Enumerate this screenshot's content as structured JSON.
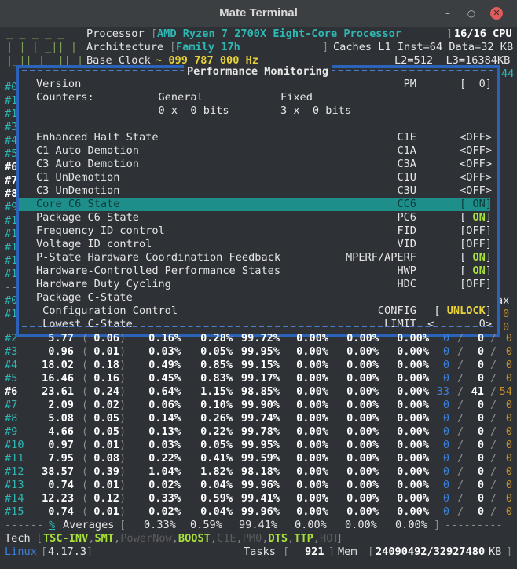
{
  "window": {
    "title": "Mate Terminal"
  },
  "header": {
    "processor_label": "Processor",
    "processor_value": "AMD Ryzen 7 2700X Eight-Core Processor",
    "cpu_count": "16/16 CPU",
    "arch_label": "Architecture",
    "arch_value": "Family 17h",
    "caches": "Caches L1 Inst=64 Data=32 KB",
    "clock_label": "Base Clock",
    "clock_value": "~ 099 787 000 Hz",
    "l2l3": "L2=512  L3=16384KB"
  },
  "modal": {
    "title": "Performance Monitoring",
    "rows": [
      {
        "label": "Version",
        "code": "PM",
        "value": "[  0]"
      },
      {
        "label": "Counters:          General            Fixed",
        "code": "",
        "value": ""
      },
      {
        "label": "                   0 x  0 bits        3 x  0 bits",
        "code": "",
        "value": ""
      },
      {
        "label": "",
        "code": "",
        "value": ""
      },
      {
        "label": "Enhanced Halt State",
        "code": "C1E",
        "value": "<OFF>"
      },
      {
        "label": "C1 Auto Demotion",
        "code": "C1A",
        "value": "<OFF>"
      },
      {
        "label": "C3 Auto Demotion",
        "code": "C3A",
        "value": "<OFF>"
      },
      {
        "label": "C1 UnDemotion",
        "code": "C1U",
        "value": "<OFF>"
      },
      {
        "label": "C3 UnDemotion",
        "code": "C3U",
        "value": "<OFF>"
      },
      {
        "label": "Core C6 State",
        "code": "CC6",
        "value": "[ ON]"
      },
      {
        "label": "Package C6 State",
        "code": "PC6",
        "value": "[ ON]"
      },
      {
        "label": "Frequency ID control",
        "code": "FID",
        "value": "[OFF]"
      },
      {
        "label": "Voltage ID control",
        "code": "VID",
        "value": "[OFF]"
      },
      {
        "label": "P-State Hardware Coordination Feedback",
        "code": "MPERF/APERF",
        "value": "[ ON]"
      },
      {
        "label": "Hardware-Controlled Performance States",
        "code": "HWP",
        "value": "[ ON]"
      },
      {
        "label": "Hardware Duty Cycling",
        "code": "HDC",
        "value": "[OFF]"
      },
      {
        "label": "Package C-State",
        "code": "",
        "value": ""
      },
      {
        "label": " Configuration Control",
        "code": "CONFIG",
        "value": "[ UNLOCK]"
      },
      {
        "label": " Lowest C-State",
        "code": "LIMIT",
        "value": "<       0>"
      }
    ],
    "highlight_index": 9
  },
  "left_margin": [
    "#0",
    "#1",
    "#1",
    "#3",
    "#4",
    "#5",
    "#6",
    "#7",
    "#8",
    "#9",
    "#1",
    "#1",
    "#1",
    "#1",
    "#1",
    "--",
    "#0",
    "#1"
  ],
  "right_margin": {
    "top": "44",
    "ax": "ax"
  },
  "cpu_rows": [
    {
      "id": "#2",
      "freq": "5.77",
      "ratio": "0.06",
      "c0": "0.16%",
      "c1": "0.28%",
      "c3": "99.72%",
      "c6": "0.00%",
      "c7": "0.00%",
      "c8": "0.00%",
      "t1": "0",
      "t2": "0",
      "t3": "0"
    },
    {
      "id": "#3",
      "freq": "0.96",
      "ratio": "0.01",
      "c0": "0.03%",
      "c1": "0.05%",
      "c3": "99.95%",
      "c6": "0.00%",
      "c7": "0.00%",
      "c8": "0.00%",
      "t1": "0",
      "t2": "0",
      "t3": "0"
    },
    {
      "id": "#4",
      "freq": "18.02",
      "ratio": "0.18",
      "c0": "0.49%",
      "c1": "0.85%",
      "c3": "99.15%",
      "c6": "0.00%",
      "c7": "0.00%",
      "c8": "0.00%",
      "t1": "0",
      "t2": "0",
      "t3": "0"
    },
    {
      "id": "#5",
      "freq": "16.46",
      "ratio": "0.16",
      "c0": "0.45%",
      "c1": "0.83%",
      "c3": "99.17%",
      "c6": "0.00%",
      "c7": "0.00%",
      "c8": "0.00%",
      "t1": "0",
      "t2": "0",
      "t3": "0"
    },
    {
      "id": "#6",
      "freq": "23.61",
      "ratio": "0.24",
      "c0": "0.64%",
      "c1": "1.15%",
      "c3": "98.85%",
      "c6": "0.00%",
      "c7": "0.00%",
      "c8": "0.00%",
      "t1": "33",
      "t2": "41",
      "t3": "54"
    },
    {
      "id": "#7",
      "freq": "2.09",
      "ratio": "0.02",
      "c0": "0.06%",
      "c1": "0.10%",
      "c3": "99.90%",
      "c6": "0.00%",
      "c7": "0.00%",
      "c8": "0.00%",
      "t1": "0",
      "t2": "0",
      "t3": "0"
    },
    {
      "id": "#8",
      "freq": "5.08",
      "ratio": "0.05",
      "c0": "0.14%",
      "c1": "0.26%",
      "c3": "99.74%",
      "c6": "0.00%",
      "c7": "0.00%",
      "c8": "0.00%",
      "t1": "0",
      "t2": "0",
      "t3": "0"
    },
    {
      "id": "#9",
      "freq": "4.66",
      "ratio": "0.05",
      "c0": "0.13%",
      "c1": "0.22%",
      "c3": "99.78%",
      "c6": "0.00%",
      "c7": "0.00%",
      "c8": "0.00%",
      "t1": "0",
      "t2": "0",
      "t3": "0"
    },
    {
      "id": "#10",
      "freq": "0.97",
      "ratio": "0.01",
      "c0": "0.03%",
      "c1": "0.05%",
      "c3": "99.95%",
      "c6": "0.00%",
      "c7": "0.00%",
      "c8": "0.00%",
      "t1": "0",
      "t2": "0",
      "t3": "0"
    },
    {
      "id": "#11",
      "freq": "7.95",
      "ratio": "0.08",
      "c0": "0.22%",
      "c1": "0.41%",
      "c3": "99.59%",
      "c6": "0.00%",
      "c7": "0.00%",
      "c8": "0.00%",
      "t1": "0",
      "t2": "0",
      "t3": "0"
    },
    {
      "id": "#12",
      "freq": "38.57",
      "ratio": "0.39",
      "c0": "1.04%",
      "c1": "1.82%",
      "c3": "98.18%",
      "c6": "0.00%",
      "c7": "0.00%",
      "c8": "0.00%",
      "t1": "0",
      "t2": "0",
      "t3": "0"
    },
    {
      "id": "#13",
      "freq": "0.74",
      "ratio": "0.01",
      "c0": "0.02%",
      "c1": "0.04%",
      "c3": "99.96%",
      "c6": "0.00%",
      "c7": "0.00%",
      "c8": "0.00%",
      "t1": "0",
      "t2": "0",
      "t3": "0"
    },
    {
      "id": "#14",
      "freq": "12.23",
      "ratio": "0.12",
      "c0": "0.33%",
      "c1": "0.59%",
      "c3": "99.41%",
      "c6": "0.00%",
      "c7": "0.00%",
      "c8": "0.00%",
      "t1": "0",
      "t2": "0",
      "t3": "0"
    },
    {
      "id": "#15",
      "freq": "0.74",
      "ratio": "0.01",
      "c0": "0.02%",
      "c1": "0.04%",
      "c3": "99.96%",
      "c6": "0.00%",
      "c7": "0.00%",
      "c8": "0.00%",
      "t1": "0",
      "t2": "0",
      "t3": "0"
    }
  ],
  "averages": {
    "label": "Averages",
    "c0": "0.33%",
    "c1": "0.59%",
    "c3": "99.41%",
    "c6": "0.00%",
    "c7": "0.00%",
    "c8": "0.00%"
  },
  "tech": {
    "label": "Tech",
    "items": [
      {
        "name": "TSC-INV",
        "on": true
      },
      {
        "name": "SMT",
        "on": true
      },
      {
        "name": "PowerNow",
        "on": false
      },
      {
        "name": "BOOST",
        "on": true
      },
      {
        "name": "C1E",
        "on": false
      },
      {
        "name": "PM0",
        "on": false
      },
      {
        "name": "DTS",
        "on": true
      },
      {
        "name": "TTP",
        "on": true
      },
      {
        "name": "HOT",
        "on": false
      }
    ]
  },
  "status": {
    "os": "Linux",
    "kernel": "4.17.3",
    "tasks_label": "Tasks",
    "tasks": "921",
    "mem_label": "Mem",
    "mem": "24090492/32927480",
    "mem_unit": "KB"
  }
}
